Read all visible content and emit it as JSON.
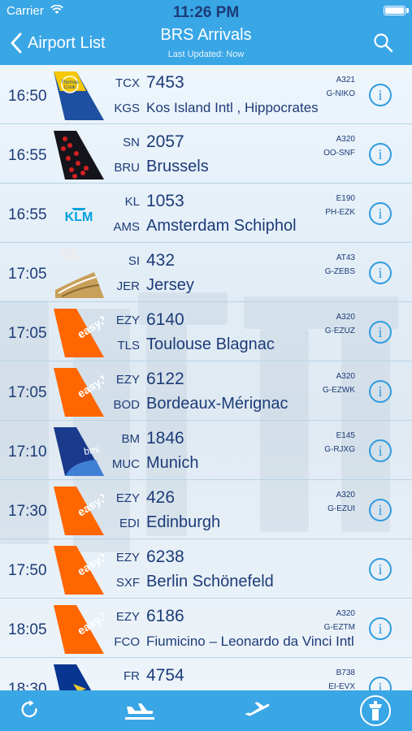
{
  "status_bar": {
    "carrier": "Carrier",
    "time": "11:26 PM"
  },
  "nav": {
    "back_label": "Airport List",
    "title": "BRS Arrivals",
    "subtitle": "Last Updated: Now"
  },
  "flights": [
    {
      "time": "16:50",
      "airline": "TCX",
      "number": "7453",
      "iata": "KGS",
      "airport": "Kos Island Intl , Hippocrates",
      "aircraft": "A321",
      "reg": "G-NIKO",
      "tail": "thomascook"
    },
    {
      "time": "16:55",
      "airline": "SN",
      "number": "2057",
      "iata": "BRU",
      "airport": "Brussels",
      "aircraft": "A320",
      "reg": "OO-SNF",
      "tail": "brussels"
    },
    {
      "time": "16:55",
      "airline": "KL",
      "number": "1053",
      "iata": "AMS",
      "airport": "Amsterdam  Schiphol",
      "aircraft": "E190",
      "reg": "PH-EZK",
      "tail": "klm"
    },
    {
      "time": "17:05",
      "airline": "SI",
      "number": "432",
      "iata": "JER",
      "airport": "Jersey",
      "aircraft": "AT43",
      "reg": "G-ZEBS",
      "tail": "blueislands"
    },
    {
      "time": "17:05",
      "airline": "EZY",
      "number": "6140",
      "iata": "TLS",
      "airport": "Toulouse Blagnac",
      "aircraft": "A320",
      "reg": "G-EZUZ",
      "tail": "easyjet"
    },
    {
      "time": "17:05",
      "airline": "EZY",
      "number": "6122",
      "iata": "BOD",
      "airport": "Bordeaux-Mérignac",
      "aircraft": "A320",
      "reg": "G-EZWK",
      "tail": "easyjet"
    },
    {
      "time": "17:10",
      "airline": "BM",
      "number": "1846",
      "iata": "MUC",
      "airport": "Munich",
      "aircraft": "E145",
      "reg": "G-RJXG",
      "tail": "bmi"
    },
    {
      "time": "17:30",
      "airline": "EZY",
      "number": "426",
      "iata": "EDI",
      "airport": "Edinburgh",
      "aircraft": "A320",
      "reg": "G-EZUI",
      "tail": "easyjet"
    },
    {
      "time": "17:50",
      "airline": "EZY",
      "number": "6238",
      "iata": "SXF",
      "airport": "Berlin Schönefeld",
      "aircraft": "",
      "reg": "",
      "tail": "easyjet"
    },
    {
      "time": "18:05",
      "airline": "EZY",
      "number": "6186",
      "iata": "FCO",
      "airport": "Fiumicino – Leonardo da Vinci Intl",
      "aircraft": "A320",
      "reg": "G-EZTM",
      "tail": "easyjet"
    },
    {
      "time": "18:30",
      "airline": "FR",
      "number": "4754",
      "iata": "",
      "airport": "",
      "aircraft": "B738",
      "reg": "EI-EVX",
      "tail": "ryanair"
    }
  ],
  "tail_text": {
    "easyjet": "easyJet",
    "klm": "KLM",
    "bmi": "bmi",
    "thomascook": "Thomas Cook"
  },
  "tabbar": {
    "items": [
      {
        "name": "refresh-tab",
        "icon": "refresh-icon"
      },
      {
        "name": "arrivals-tab",
        "icon": "plane-landing-icon"
      },
      {
        "name": "departures-tab",
        "icon": "plane-takeoff-icon"
      },
      {
        "name": "tower-tab",
        "icon": "control-tower-icon"
      }
    ]
  },
  "colors": {
    "bar": "#39a6e6",
    "text": "#1c3b78",
    "info": "#2f9be0",
    "easyjet": "#ff6600"
  }
}
